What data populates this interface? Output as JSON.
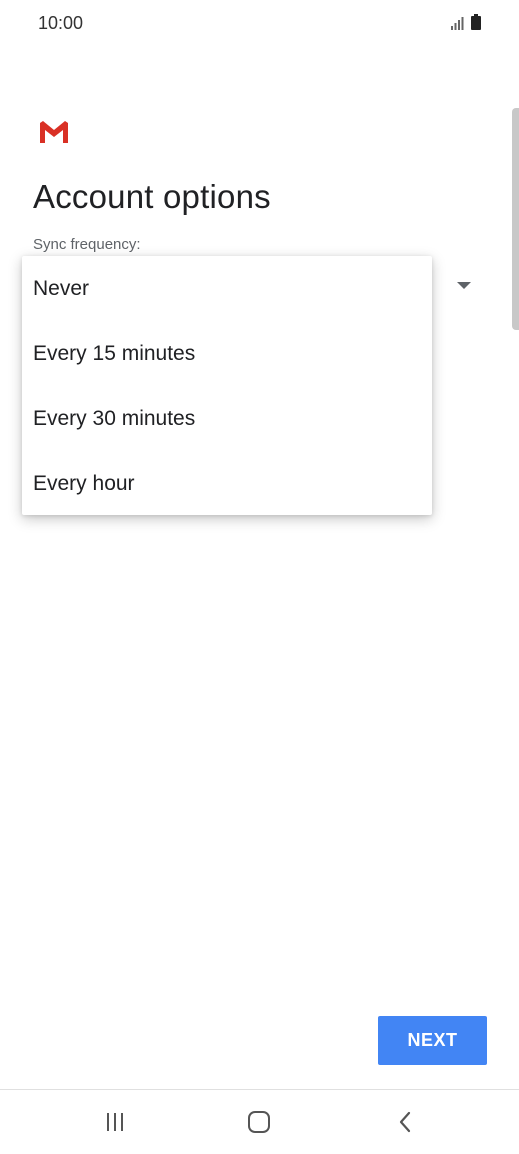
{
  "status_bar": {
    "time": "10:00",
    "icons": [
      "signal-icon",
      "battery-icon"
    ]
  },
  "app": {
    "logo": "gmail-logo-icon",
    "brand_color": "#d93025"
  },
  "header": {
    "title": "Account options"
  },
  "sync": {
    "label": "Sync frequency:"
  },
  "dropdown": {
    "options": [
      "Never",
      "Every 15 minutes",
      "Every 30 minutes",
      "Every hour"
    ]
  },
  "actions": {
    "next_label": "NEXT",
    "accent": "#4285f4"
  },
  "nav": {
    "icons": [
      "recent-apps-icon",
      "home-icon",
      "back-icon"
    ]
  }
}
